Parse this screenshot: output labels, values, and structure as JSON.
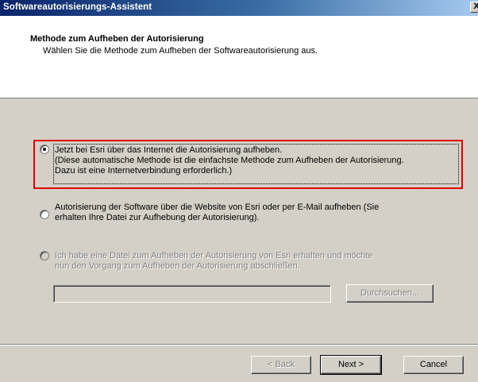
{
  "window": {
    "title": "Softwareautorisierungs-Assistent",
    "close_glyph": "X"
  },
  "header": {
    "title": "Methode zum Aufheben der Autorisierung",
    "subtitle": "Wählen Sie die Methode zum Aufheben der Softwareautorisierung aus."
  },
  "options": [
    {
      "selected": true,
      "enabled": true,
      "lines": [
        "Jetzt bei Esri über das Internet die Autorisierung aufheben.",
        "(Diese automatische Methode ist die einfachste Methode zum Aufheben der Autorisierung.",
        "Dazu ist eine Internetverbindung erforderlich.)"
      ]
    },
    {
      "selected": false,
      "enabled": true,
      "lines": [
        "Autorisierung der Software über die Website von Esri oder per E-Mail aufheben (Sie",
        "erhalten Ihre Datei zur Aufhebung der Autorisierung)."
      ]
    },
    {
      "selected": false,
      "enabled": false,
      "lines": [
        "Ich habe eine Datei zum Aufheben der Autorisierung von Esri erhalten und möchte",
        "nun den Vorgang zum Aufheben der Autorisierung abschließen."
      ]
    }
  ],
  "file_path": {
    "value": "",
    "browse_label": "Durchsuchen..."
  },
  "footer": {
    "back_label": "< Back",
    "next_label": "Next >",
    "cancel_label": "Cancel"
  },
  "colors": {
    "highlight": "#e00000",
    "title_bar": "#0a246a",
    "dialog_face": "#d4d0c8"
  }
}
